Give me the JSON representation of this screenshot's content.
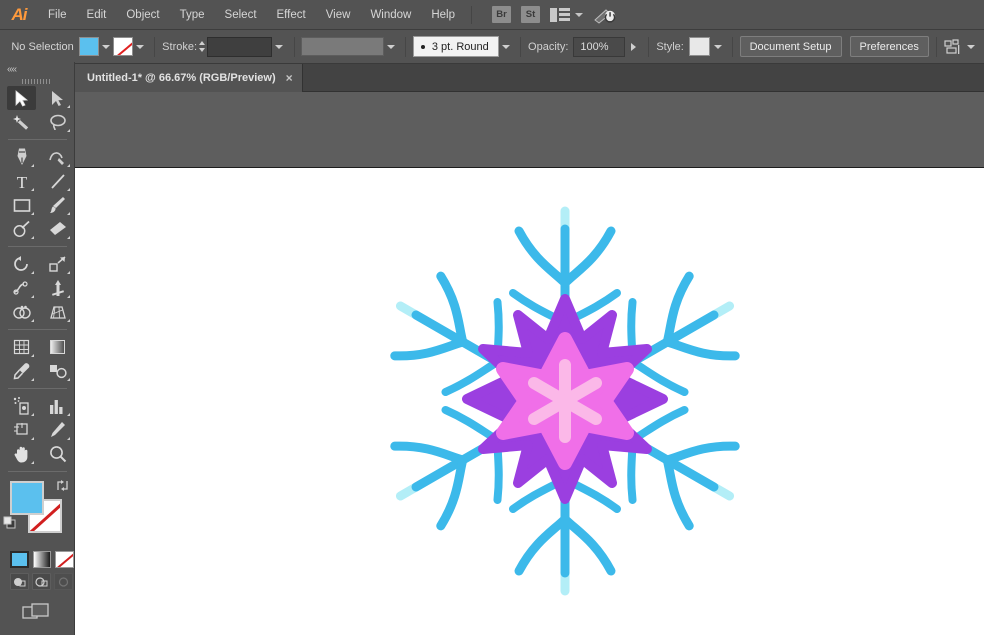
{
  "app": {
    "logo": "Ai"
  },
  "menubar": {
    "items": [
      {
        "label": "File"
      },
      {
        "label": "Edit"
      },
      {
        "label": "Object"
      },
      {
        "label": "Type"
      },
      {
        "label": "Select"
      },
      {
        "label": "Effect"
      },
      {
        "label": "View"
      },
      {
        "label": "Window"
      },
      {
        "label": "Help"
      }
    ],
    "bridge_label": "Br",
    "stock_label": "St",
    "arrange_icon": "arrange-documents-icon",
    "workspace_icon": "workspace-switcher-icon"
  },
  "controlbar": {
    "selection_status": "No Selection",
    "fill_label": "fill-swatch",
    "fill_color": "#5bc0ee",
    "stroke_swatch_label": "stroke-swatch",
    "stroke_label": "Stroke:",
    "stroke_weight_value": "",
    "variable_width_value": "",
    "brush_label": "3 pt. Round",
    "opacity_label": "Opacity:",
    "opacity_value": "100%",
    "style_label": "Style:",
    "document_setup_label": "Document Setup",
    "preferences_label": "Preferences",
    "align_icon": "align-objects-icon"
  },
  "tabbar": {
    "tab_title": "Untitled-1* @ 66.67% (RGB/Preview)",
    "close_label": "×"
  },
  "toolbar": {
    "collapse_label": "««",
    "tools": [
      {
        "name": "selection-tool",
        "active": true
      },
      {
        "name": "direct-selection-tool",
        "active": false
      },
      {
        "name": "magic-wand-tool",
        "active": false
      },
      {
        "name": "lasso-tool",
        "active": false
      },
      {
        "name": "pen-tool",
        "active": false
      },
      {
        "name": "curvature-tool",
        "active": false
      },
      {
        "name": "type-tool",
        "active": false
      },
      {
        "name": "line-segment-tool",
        "active": false
      },
      {
        "name": "rectangle-tool",
        "active": false
      },
      {
        "name": "paintbrush-tool",
        "active": false
      },
      {
        "name": "shaper-tool",
        "active": false
      },
      {
        "name": "eraser-tool",
        "active": false
      },
      {
        "name": "rotate-tool",
        "active": false
      },
      {
        "name": "scale-tool",
        "active": false
      },
      {
        "name": "width-tool",
        "active": false
      },
      {
        "name": "free-transform-tool",
        "active": false
      },
      {
        "name": "shape-builder-tool",
        "active": false
      },
      {
        "name": "perspective-grid-tool",
        "active": false
      },
      {
        "name": "mesh-tool",
        "active": false
      },
      {
        "name": "gradient-tool",
        "active": false
      },
      {
        "name": "eyedropper-tool",
        "active": false
      },
      {
        "name": "blend-tool",
        "active": false
      },
      {
        "name": "symbol-sprayer-tool",
        "active": false
      },
      {
        "name": "column-graph-tool",
        "active": false
      },
      {
        "name": "artboard-tool",
        "active": false
      },
      {
        "name": "slice-tool",
        "active": false
      },
      {
        "name": "hand-tool",
        "active": false
      },
      {
        "name": "zoom-tool",
        "active": false
      }
    ],
    "fill_color": "#5bc0ee",
    "stroke_color": "none",
    "color_button": "color-mode-button",
    "gradient_button": "gradient-mode-button",
    "none_button": "none-mode-button",
    "draw_normal": "draw-normal-button",
    "draw_behind": "draw-behind-button",
    "draw_inside": "draw-inside-button",
    "screen_mode": "screen-mode-button"
  },
  "artwork": {
    "name": "snowflake-illustration",
    "colors": {
      "pale_cyan": "#b3eef7",
      "blue": "#3cb9ea",
      "purple": "#9b3fe0",
      "pink": "#f06fe8",
      "pale_pink": "#fbb8e8",
      "artboard": "#ffffff"
    },
    "arms": 6,
    "star_points": 12
  }
}
